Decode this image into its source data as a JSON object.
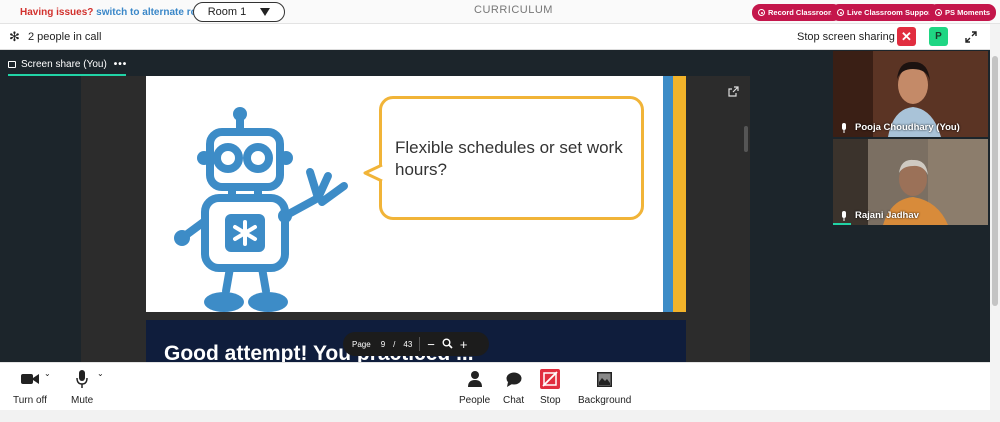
{
  "topbar": {
    "issue_text": "Having issues?",
    "alt_link": "switch to alternate room",
    "room_label": "Room 1",
    "curriculum": "CURRICULUM",
    "pills": [
      "Record Classroom",
      "Live Classroom Support",
      "PS Moments"
    ],
    "pill_color": "#c4164b"
  },
  "callbar": {
    "people_count": "2 people in call",
    "stop_share": "Stop screen sharing",
    "profile_initial": "P"
  },
  "share_tab": {
    "label": "Screen share (You)",
    "menu": "•••"
  },
  "slide": {
    "question": "Flexible schedules or set work hours?",
    "next_slide_heading": "Good attempt! You practiced ..."
  },
  "pager": {
    "label": "Page",
    "current": "9",
    "separator": "/",
    "total": "43"
  },
  "participants": [
    {
      "name": "Pooja Choudhary (You)"
    },
    {
      "name": "Rajani Jadhav"
    }
  ],
  "toolbar": {
    "camera": "Turn off",
    "mic": "Mute",
    "people": "People",
    "chat": "Chat",
    "stop": "Stop",
    "background": "Background"
  },
  "colors": {
    "accent": "#21d3a6",
    "danger": "#e12d3f",
    "robot_blue": "#3d8cc7",
    "bubble_yellow": "#f1b438"
  }
}
